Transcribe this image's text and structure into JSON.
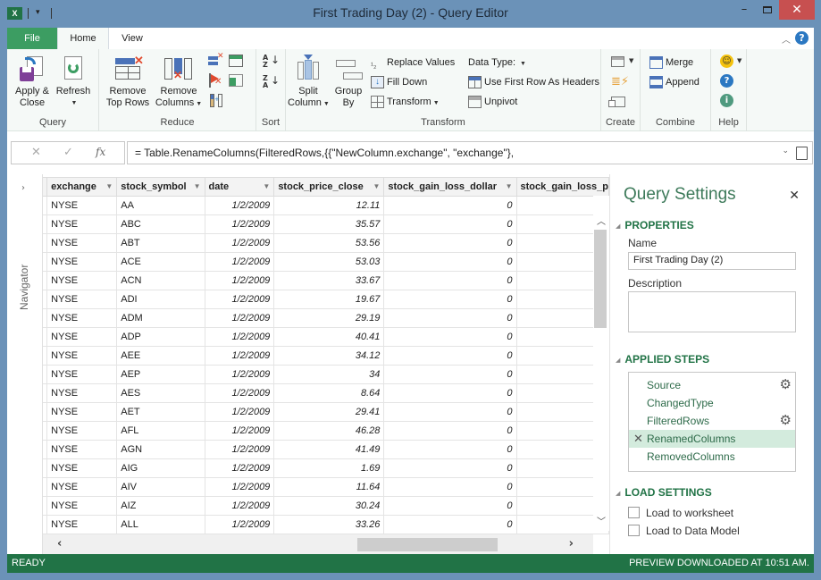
{
  "window": {
    "title": "First Trading Day (2) - Query Editor",
    "app_icon": "X",
    "controls": {
      "minimize": "–",
      "close": "✕"
    }
  },
  "tabs": [
    {
      "label": "File",
      "active": false
    },
    {
      "label": "Home",
      "active": true
    },
    {
      "label": "View",
      "active": false
    }
  ],
  "ribbon": {
    "groups": {
      "query": "Query",
      "reduce": "Reduce",
      "sort": "Sort",
      "transform": "Transform",
      "create": "Create",
      "combine": "Combine",
      "help": "Help"
    },
    "apply_close": [
      "Apply &",
      "Close"
    ],
    "refresh": "Refresh",
    "remove_top_rows": [
      "Remove",
      "Top Rows"
    ],
    "remove_columns": [
      "Remove",
      "Columns"
    ],
    "split_column": [
      "Split",
      "Column"
    ],
    "group_by": [
      "Group",
      "By"
    ],
    "replace_values": "Replace Values",
    "fill_down": "Fill Down",
    "transform": "Transform",
    "data_type": "Data Type:",
    "use_first_row": "Use First Row As Headers",
    "unpivot": "Unpivot",
    "merge": "Merge",
    "append": "Append"
  },
  "formula": {
    "cancel": "✕",
    "confirm": "✓",
    "fx": "fx",
    "text": "= Table.RenameColumns(FilteredRows,{{\"NewColumn.exchange\", \"exchange\"},"
  },
  "navigator": {
    "label": "Navigator"
  },
  "grid": {
    "columns": [
      "exchange",
      "stock_symbol",
      "date",
      "stock_price_close",
      "stock_gain_loss_dollar",
      "stock_gain_loss_p"
    ],
    "rows": [
      [
        "NYSE",
        "AA",
        "1/2/2009",
        "12.11",
        "0"
      ],
      [
        "NYSE",
        "ABC",
        "1/2/2009",
        "35.57",
        "0"
      ],
      [
        "NYSE",
        "ABT",
        "1/2/2009",
        "53.56",
        "0"
      ],
      [
        "NYSE",
        "ACE",
        "1/2/2009",
        "53.03",
        "0"
      ],
      [
        "NYSE",
        "ACN",
        "1/2/2009",
        "33.67",
        "0"
      ],
      [
        "NYSE",
        "ADI",
        "1/2/2009",
        "19.67",
        "0"
      ],
      [
        "NYSE",
        "ADM",
        "1/2/2009",
        "29.19",
        "0"
      ],
      [
        "NYSE",
        "ADP",
        "1/2/2009",
        "40.41",
        "0"
      ],
      [
        "NYSE",
        "AEE",
        "1/2/2009",
        "34.12",
        "0"
      ],
      [
        "NYSE",
        "AEP",
        "1/2/2009",
        "34",
        "0"
      ],
      [
        "NYSE",
        "AES",
        "1/2/2009",
        "8.64",
        "0"
      ],
      [
        "NYSE",
        "AET",
        "1/2/2009",
        "29.41",
        "0"
      ],
      [
        "NYSE",
        "AFL",
        "1/2/2009",
        "46.28",
        "0"
      ],
      [
        "NYSE",
        "AGN",
        "1/2/2009",
        "41.49",
        "0"
      ],
      [
        "NYSE",
        "AIG",
        "1/2/2009",
        "1.69",
        "0"
      ],
      [
        "NYSE",
        "AIV",
        "1/2/2009",
        "11.64",
        "0"
      ],
      [
        "NYSE",
        "AIZ",
        "1/2/2009",
        "30.24",
        "0"
      ],
      [
        "NYSE",
        "ALL",
        "1/2/2009",
        "33.26",
        "0"
      ]
    ]
  },
  "settings": {
    "title": "Query Settings",
    "properties_header": "PROPERTIES",
    "name_label": "Name",
    "name_value": "First Trading Day (2)",
    "description_label": "Description",
    "description_value": "",
    "applied_steps_header": "APPLIED STEPS",
    "steps": [
      {
        "label": "Source",
        "gear": true,
        "active": false
      },
      {
        "label": "ChangedType",
        "gear": false,
        "active": false
      },
      {
        "label": "FilteredRows",
        "gear": true,
        "active": false
      },
      {
        "label": "RenamedColumns",
        "gear": false,
        "active": true
      },
      {
        "label": "RemovedColumns",
        "gear": false,
        "active": false
      }
    ],
    "load_settings_header": "LOAD SETTINGS",
    "load_to_worksheet": {
      "label": "Load to worksheet",
      "checked": false
    },
    "load_to_data_model": {
      "label": "Load to Data Model",
      "checked": false
    }
  },
  "status": {
    "left": "READY",
    "right": "PREVIEW DOWNLOADED AT 10:51 AM."
  }
}
